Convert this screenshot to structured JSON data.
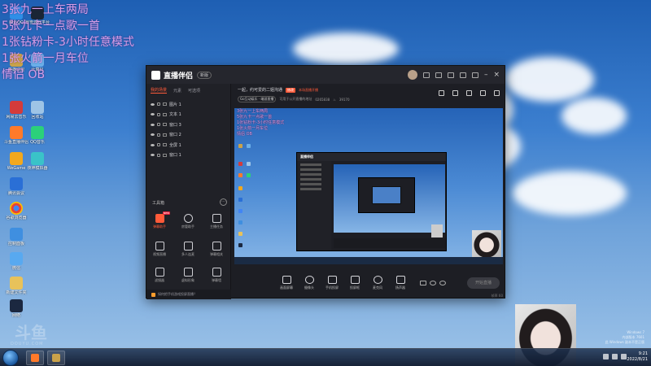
{
  "overlay_lines": [
    "3张九一上车两局",
    "5张九卡一点歌一首",
    "1张钻粉卡-3小时任意模式",
    "1张火箭一月车位",
    "情侣 OB"
  ],
  "desktop_icons": [
    "腾讯QQ",
    "暴雪游戏平台",
    "英雄联盟",
    "计算机",
    "网易云音乐",
    "回收站",
    "斗鱼直播伴侣",
    "QQ音乐",
    "WeGame",
    "夜神模拟器",
    "腾讯会议",
    "谷歌浏览器",
    "控制面板",
    "新建文件夹",
    "网络",
    "微信"
  ],
  "window": {
    "title": "直播伴侣",
    "version": "新版",
    "left_tabs": [
      "我的场景",
      "元素",
      "可选项"
    ],
    "scenes": [
      "图片 1",
      "文本 1",
      "窗口 3",
      "窗口 2",
      "全屏 1",
      "窗口 1"
    ],
    "toolbox_title": "工具箱",
    "tools": [
      {
        "label": "弹幕助手",
        "hot": true
      },
      {
        "label": "房管助手",
        "hot": false
      },
      {
        "label": "主播任务",
        "hot": false
      },
      {
        "label": "视频直播",
        "hot": false
      },
      {
        "label": "多人连麦",
        "hot": false
      },
      {
        "label": "弹幕相关",
        "hot": false
      },
      {
        "label": "滤镜器",
        "hot": false
      },
      {
        "label": "虚拟形象",
        "hot": false
      },
      {
        "label": "弹幕墙",
        "hot": false
      }
    ],
    "new_tag": "NEW",
    "notice": "如何把手机游戏投屏直播？",
    "room_title": "一起，约可爱的二姐沟通",
    "edit_label": "修改",
    "hot_label": "本场直播开播",
    "category": "Go互动娱乐 · 端游直播",
    "meta_text": "可用于公开直播的地址",
    "room_id": "0265838",
    "hot_count": "39170",
    "controls": [
      "画面屏幕",
      "摄像头",
      "手机投屏",
      "投屏框",
      "麦克风",
      "扬声器"
    ],
    "start_label": "开始直播",
    "status_left": "",
    "status_right": "帧率 60"
  },
  "nested_title": "直播伴侣",
  "watermark": "斗鱼",
  "watermark_sub": "DOUYU.COM",
  "windows_notice": [
    "Windows 7",
    "内部版本 7601",
    "此 Windows 副本不是正版"
  ],
  "clock": {
    "time": "9:21",
    "date": "2022/8/21"
  },
  "colors": {
    "accent": "#ff5a39",
    "overlay_text": "#d59ee6",
    "window_bg": "#1d1e24"
  }
}
